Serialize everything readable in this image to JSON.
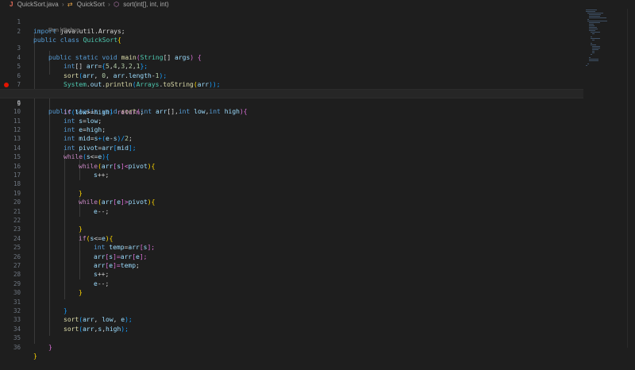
{
  "breadcrumb": {
    "file": "QuickSort.java",
    "class_name": "QuickSort",
    "method": "sort(int[], int, int)"
  },
  "codelens": {
    "run": "Run",
    "sep": "|",
    "debug": "Debug"
  },
  "line_numbers": [
    "1",
    "2",
    "3",
    "4",
    "5",
    "6",
    "7",
    "8",
    "9",
    "10",
    "11",
    "12",
    "13",
    "14",
    "15",
    "16",
    "17",
    "18",
    "19",
    "20",
    "21",
    "22",
    "23",
    "24",
    "25",
    "26",
    "27",
    "28",
    "29",
    "30",
    "31",
    "32",
    "33",
    "34",
    "35",
    "36"
  ],
  "code": {
    "l1": [
      "import",
      " java.util.Arrays;"
    ],
    "l2": [
      "public",
      " ",
      "class",
      " ",
      "QuickSort",
      "{"
    ],
    "l3": [
      "public",
      " ",
      "static",
      " ",
      "void",
      " ",
      "main",
      "(",
      "String",
      "[] ",
      "args",
      ") {"
    ],
    "l4": [
      "int",
      "[] ",
      "arr",
      "=",
      "{",
      "5",
      ",",
      "4",
      ",",
      "3",
      ",",
      "2",
      ",",
      "1",
      "};"
    ],
    "l5": [
      "sort",
      "(",
      "arr",
      ", ",
      "0",
      ", ",
      "arr",
      ".",
      "length",
      "-",
      "1",
      ");"
    ],
    "l6": [
      "System",
      ".",
      "out",
      ".",
      "println",
      "(",
      "Arrays",
      ".",
      "toString",
      "(",
      "arr",
      "));"
    ],
    "l7": [
      "}"
    ],
    "l8": [
      "public",
      " ",
      "static",
      " ",
      "void",
      " ",
      "sort",
      "(",
      "int",
      " ",
      "arr",
      "[],",
      "int",
      " ",
      "low",
      ",",
      "int",
      " ",
      "high",
      "){"
    ],
    "l9": [
      "if",
      "(",
      "low",
      ">=",
      "high",
      ") ",
      "return",
      ";"
    ],
    "l10": [
      "int",
      " ",
      "s",
      "=",
      "low",
      ";"
    ],
    "l11": [
      "int",
      " ",
      "e",
      "=",
      "high",
      ";"
    ],
    "l12": [
      "int",
      " ",
      "mid",
      "=",
      "s",
      "+(",
      "e",
      "-",
      "s",
      ")/",
      "2",
      ";"
    ],
    "l13": [
      "int",
      " ",
      "pivot",
      "=",
      "arr",
      "[",
      "mid",
      "];"
    ],
    "l14": [
      "while",
      "(",
      "s",
      "<=",
      "e",
      "){"
    ],
    "l15": [
      "while",
      "(",
      "arr",
      "[",
      "s",
      "]<",
      "pivot",
      "){"
    ],
    "l16": [
      "s",
      "++;"
    ],
    "l18": [
      "}"
    ],
    "l19": [
      "while",
      "(",
      "arr",
      "[",
      "e",
      "]>",
      "pivot",
      "){"
    ],
    "l20": [
      "e",
      "--;"
    ],
    "l22": [
      "}"
    ],
    "l23": [
      "if",
      "(",
      "s",
      "<=",
      "e",
      "){"
    ],
    "l24": [
      "int",
      " ",
      "temp",
      "=",
      "arr",
      "[",
      "s",
      "];"
    ],
    "l25": [
      "arr",
      "[",
      "s",
      "]=",
      "arr",
      "[",
      "e",
      "];"
    ],
    "l26": [
      "arr",
      "[",
      "e",
      "]=",
      "temp",
      ";"
    ],
    "l27": [
      "s",
      "++;"
    ],
    "l28": [
      "e",
      "--;"
    ],
    "l29": [
      "}"
    ],
    "l31": [
      "}"
    ],
    "l32": [
      "sort",
      "(",
      "arr",
      ", ",
      "low",
      ", ",
      "e",
      ");"
    ],
    "l33": [
      "sort",
      "(",
      "arr",
      ",",
      "s",
      ",",
      "high",
      ");"
    ],
    "l35": [
      "}"
    ],
    "l36": [
      "}"
    ]
  },
  "colors": {
    "keyword": "#569cd6",
    "control": "#c586c0",
    "type": "#4ec9b0",
    "function": "#dcdcaa",
    "variable": "#9cdcfe",
    "number": "#b5cea8",
    "breakpoint": "#e51400"
  },
  "icons": [
    "java-file-icon",
    "class-icon",
    "method-icon",
    "breakpoint-icon"
  ]
}
